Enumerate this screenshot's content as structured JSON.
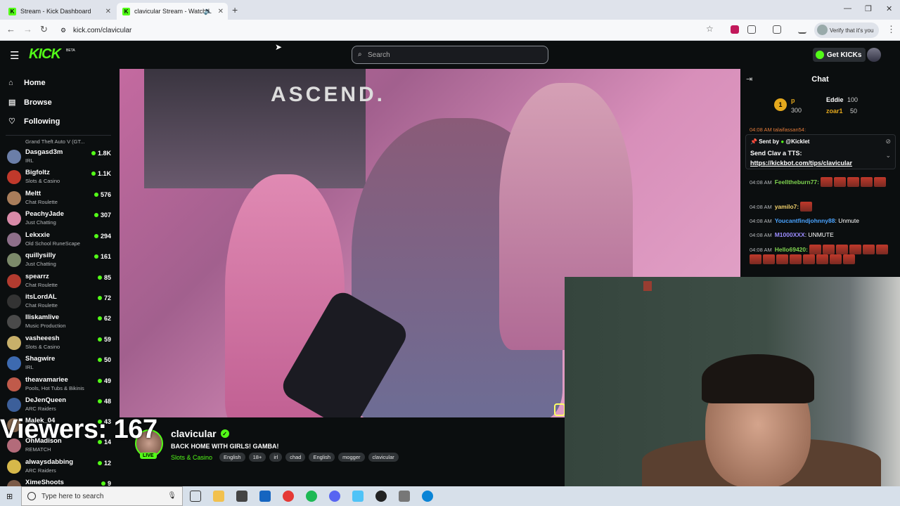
{
  "browser": {
    "tabs": [
      {
        "label": "Stream - Kick Dashboard"
      },
      {
        "label": "clavicular Stream - Watch L"
      }
    ],
    "url": "kick.com/clavicular",
    "verify_label": "Verify that it's you"
  },
  "header": {
    "logo": "KICK",
    "beta": "BETA",
    "search_placeholder": "Search",
    "get_kicks": "Get KICKs"
  },
  "sidebar": {
    "nav": [
      {
        "label": "Home"
      },
      {
        "label": "Browse"
      },
      {
        "label": "Following"
      }
    ],
    "top_partial_category": "Grand Theft Auto V (GT...",
    "channels": [
      {
        "name": "Dasgasd3m",
        "category": "IRL",
        "viewers": "1.8K"
      },
      {
        "name": "Bigfoltz",
        "category": "Slots & Casino",
        "viewers": "1.1K"
      },
      {
        "name": "Meltt",
        "category": "Chat Roulette",
        "viewers": "576"
      },
      {
        "name": "PeachyJade",
        "category": "Just Chatting",
        "viewers": "307"
      },
      {
        "name": "Lekxxie",
        "category": "Old School RuneScape",
        "viewers": "294"
      },
      {
        "name": "quillysilly",
        "category": "Just Chatting",
        "viewers": "161"
      },
      {
        "name": "spearrz",
        "category": "Chat Roulette",
        "viewers": "85"
      },
      {
        "name": "itsLordAL",
        "category": "Chat Roulette",
        "viewers": "72"
      },
      {
        "name": "lliskamlive",
        "category": "Music Production",
        "viewers": "62"
      },
      {
        "name": "vasheeesh",
        "category": "Slots & Casino",
        "viewers": "59"
      },
      {
        "name": "Shagwire",
        "category": "IRL",
        "viewers": "50"
      },
      {
        "name": "theavamariee",
        "category": "Pools, Hot Tubs & Bikinis",
        "viewers": "49"
      },
      {
        "name": "DeJenQueen",
        "category": "ARC Raiders",
        "viewers": "48"
      },
      {
        "name": "Malek_04",
        "category": "",
        "viewers": "43"
      },
      {
        "name": "OhMadison",
        "category": "REMATCH",
        "viewers": "14"
      },
      {
        "name": "alwaysdabbing",
        "category": "ARC Raiders",
        "viewers": "12"
      },
      {
        "name": "XimeShoots",
        "category": "",
        "viewers": "9"
      }
    ]
  },
  "video": {
    "banner_text": "ASCEND."
  },
  "overlay": {
    "viewers": "Viewers: 167"
  },
  "stream": {
    "streamer": "clavicular",
    "live": "LIVE",
    "title": "BACK HOME WITH GIRLS! GAMBA!",
    "category": "Slots & Casino",
    "tags": [
      "English",
      "18+",
      "irl",
      "chad",
      "English",
      "mogger",
      "clavicular"
    ]
  },
  "chat": {
    "title": "Chat",
    "leaderboard": {
      "rank1_label": "1",
      "p_name": "p",
      "p_score": "300",
      "eddie_name": "Eddie",
      "eddie_score": "100",
      "zoar_name": "zoar1",
      "zoar_score": "50"
    },
    "partial_top": "04:08 AM  talaifassan54:",
    "pinned": {
      "sent_by": "Sent by",
      "sender": "@Kicklet",
      "message": "Send Clav a TTS:",
      "link": "https://kickbot.com/tips/clavicular"
    },
    "messages": [
      {
        "time": "04:08 AM",
        "user": "Feelltheburn77:",
        "text": "",
        "color": "#7fd34f",
        "emotes": 6
      },
      {
        "time": "04:08 AM",
        "user": "yamilo7:",
        "text": "",
        "color": "#f2d16b",
        "emotes": 1
      },
      {
        "time": "04:08 AM",
        "user": "Youcantfindjohnny88",
        "text": ": Unmute",
        "color": "#4aa3ff",
        "emotes": 0
      },
      {
        "time": "04:08 AM",
        "user": "M1000XXX",
        "text": ": UNMUTE",
        "color": "#9b8cff",
        "emotes": 0
      },
      {
        "time": "04:08 AM",
        "user": "Hello69420:",
        "text": "",
        "color": "#7fd34f",
        "emotes": 15
      }
    ]
  },
  "taskbar": {
    "search_placeholder": "Type here to search"
  },
  "colors": {
    "accent": "#53fc18",
    "background": "#0b0e0f"
  }
}
